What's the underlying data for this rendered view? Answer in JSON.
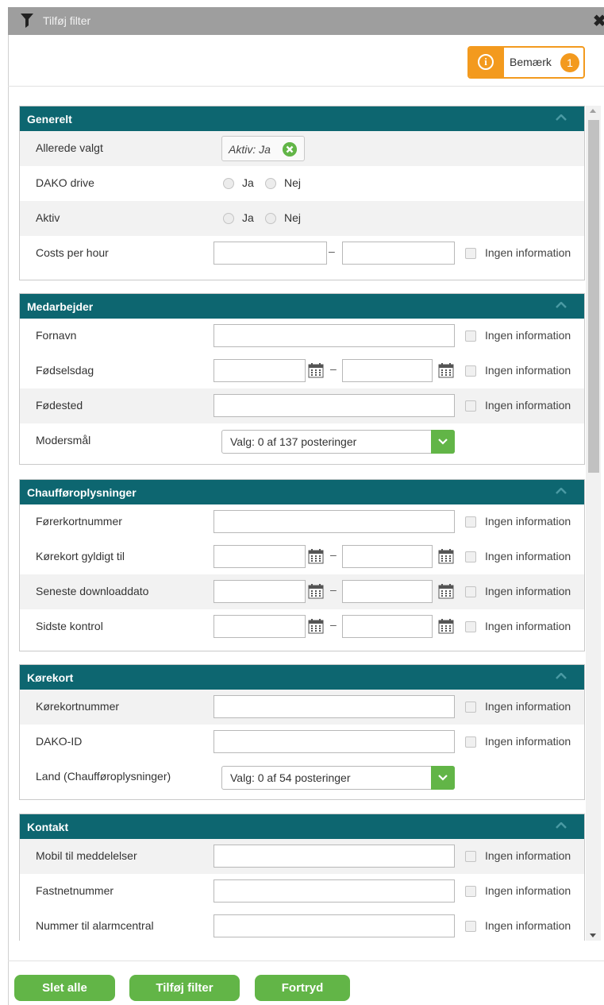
{
  "dialog": {
    "title": "Tilføj filter",
    "close_symbol": "✖"
  },
  "notice": {
    "icon_symbol": "i",
    "label": "Bemærk",
    "count": "1"
  },
  "common": {
    "no_info": "Ingen information",
    "dash": "–",
    "yes": "Ja",
    "no": "Nej"
  },
  "sections": {
    "generelt": {
      "title": "Generelt",
      "already_selected_label": "Allerede valgt",
      "chip_text": "Aktiv: Ja",
      "dako_drive_label": "DAKO drive",
      "aktiv_label": "Aktiv",
      "costs_label": "Costs per hour"
    },
    "medarbejder": {
      "title": "Medarbejder",
      "fornavn_label": "Fornavn",
      "birthday_label": "Fødselsdag",
      "birthplace_label": "Fødested",
      "mother_tongue_label": "Modersmål",
      "mother_tongue_select": "Valg: 0 af 137 posteringer"
    },
    "chauffor": {
      "title": "Chaufføroplysninger",
      "license_number_label": "Førerkortnummer",
      "license_valid_label": "Kørekort gyldigt til",
      "last_download_label": "Seneste downloaddato",
      "last_check_label": "Sidste kontrol"
    },
    "korekort": {
      "title": "Kørekort",
      "korekort_number_label": "Kørekortnummer",
      "dako_id_label": "DAKO-ID",
      "country_label": "Land (Chaufføroplysninger)",
      "country_select": "Valg: 0 af 54 posteringer"
    },
    "kontakt": {
      "title": "Kontakt",
      "mobile_label": "Mobil til meddelelser",
      "landline_label": "Fastnetnummer",
      "alarm_label": "Nummer til alarmcentral"
    }
  },
  "footer": {
    "delete_all": "Slet alle",
    "add_filter": "Tilføj filter",
    "cancel": "Fortryd"
  },
  "colors": {
    "section_header": "#0d6670",
    "accent_green": "#62b547",
    "notice_orange": "#f39a1e",
    "titlebar": "#9e9e9e"
  },
  "icons": {
    "title": "filter-icon",
    "close": "close-icon",
    "notice": "info-icon",
    "section_toggle": "chevron-up-icon",
    "date": "calendar-icon",
    "chip_remove": "remove-circle-icon",
    "select_toggle": "chevron-down-icon"
  }
}
